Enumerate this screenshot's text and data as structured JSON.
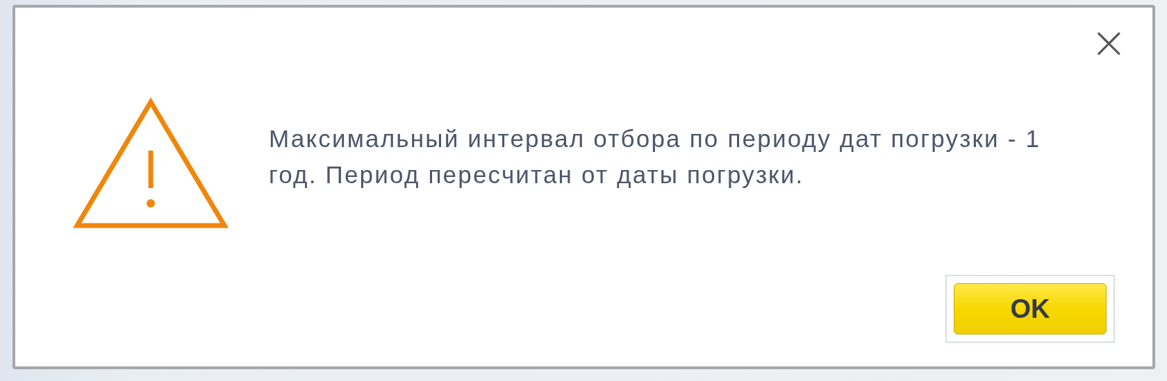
{
  "dialog": {
    "message": "Максимальный интервал отбора по периоду дат погрузки - 1 год. Период пересчитан от даты погрузки.",
    "close": "×",
    "buttons": [
      {
        "label": "OK",
        "default": true
      }
    ]
  }
}
